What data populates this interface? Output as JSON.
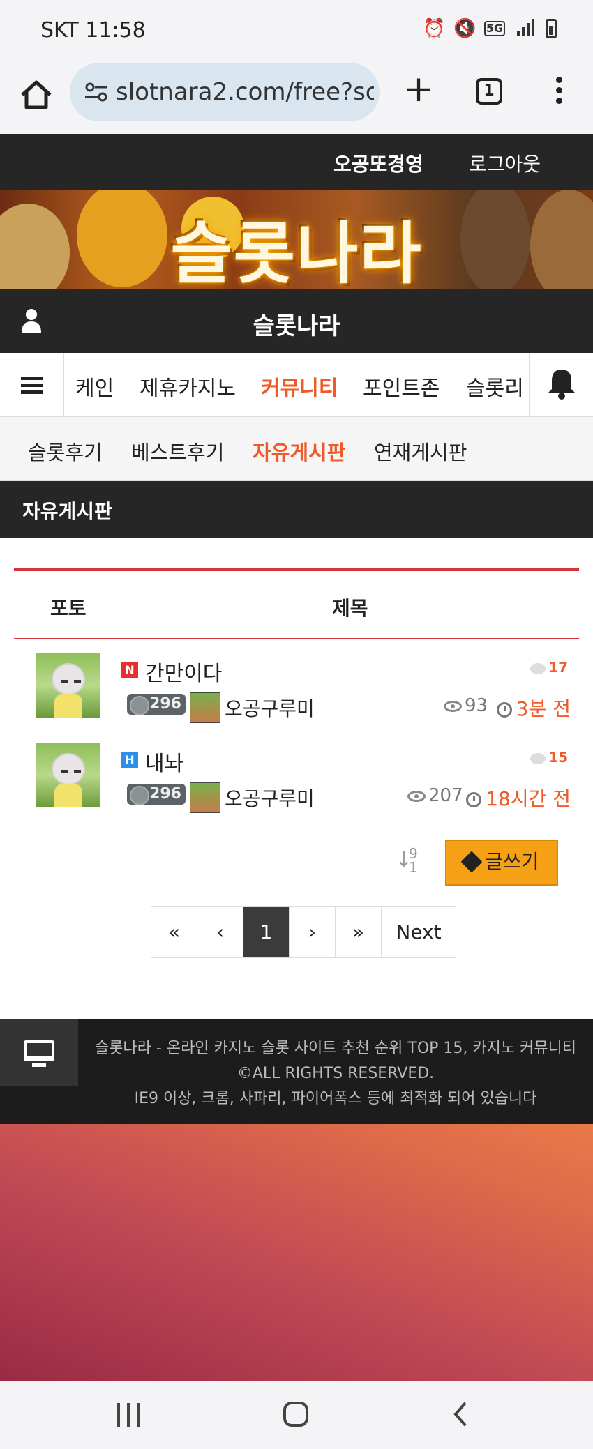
{
  "status": {
    "time": "SKT 11:58",
    "network": "5G"
  },
  "browser": {
    "url": "slotnara2.com/free?sc",
    "tab_count": "1"
  },
  "topbar": {
    "username": "오공또경영",
    "logout": "로그아웃"
  },
  "banner": {
    "title": "슬롯나라"
  },
  "site": {
    "title": "슬롯나라"
  },
  "nav": {
    "items": [
      {
        "label": "케인",
        "active": false
      },
      {
        "label": "제휴카지노",
        "active": false
      },
      {
        "label": "커뮤니티",
        "active": true
      },
      {
        "label": "포인트존",
        "active": false
      },
      {
        "label": "슬롯리",
        "active": false
      }
    ]
  },
  "subnav": {
    "items": [
      {
        "label": "슬롯후기"
      },
      {
        "label": "베스트후기"
      },
      {
        "label": "자유게시판"
      },
      {
        "label": "연재게시판"
      }
    ]
  },
  "page": {
    "title": "자유게시판"
  },
  "board": {
    "col_photo": "포토",
    "col_title": "제목",
    "posts": [
      {
        "badge": "N",
        "title": "간만이다",
        "comments": "17",
        "level": "296",
        "author": "오공구루미",
        "views": "93",
        "time": "3분 전"
      },
      {
        "badge": "H",
        "title": "내놔",
        "comments": "15",
        "level": "296",
        "author": "오공구루미",
        "views": "207",
        "time": "18시간 전"
      }
    ],
    "sort_top": "9",
    "sort_bottom": "1",
    "write_label": "글쓰기"
  },
  "pagination": {
    "first": "«",
    "prev": "‹",
    "current": "1",
    "next_arrow": "›",
    "last": "»",
    "next_label": "Next"
  },
  "footer": {
    "line1": "슬롯나라 - 온라인 카지노 슬롯 사이트 추천 순위 TOP 15, 카지노 커뮤니티",
    "line2": "©ALL RIGHTS RESERVED.",
    "line3": "IE9 이상, 크롬, 사파리, 파이어폭스 등에 최적화 되어 있습니다"
  },
  "colors": {
    "accent": "#f05a28",
    "board_line": "#d7333d",
    "write_button": "#f5a015",
    "dark_bar": "#262626"
  }
}
